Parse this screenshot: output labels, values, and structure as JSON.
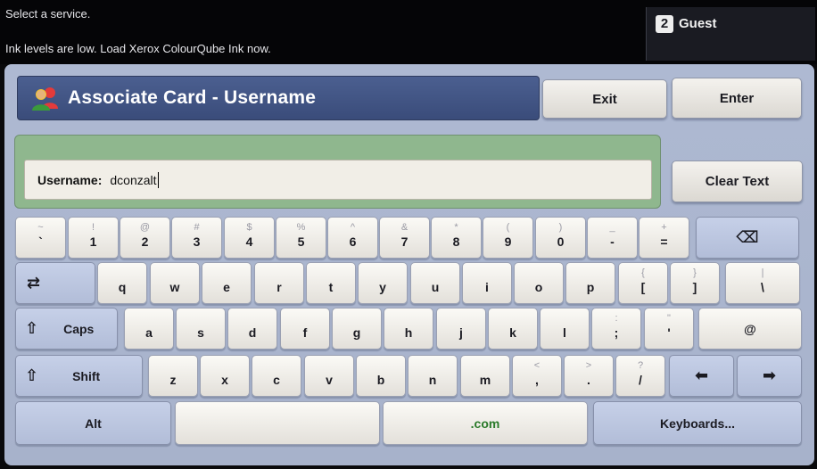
{
  "status": {
    "line1": "Select a service.",
    "line2": "Ink levels are low. Load Xerox ColourQube Ink now."
  },
  "guest": {
    "icon": "user-help-icon",
    "icon_glyph": "2",
    "label": "Guest"
  },
  "header": {
    "title": "Associate Card - Username",
    "icon": "people-icon"
  },
  "buttons": {
    "exit": "Exit",
    "enter": "Enter",
    "clear_text": "Clear Text"
  },
  "username": {
    "label": "Username:",
    "value": "dconzalt"
  },
  "keyboard": {
    "rows": [
      [
        {
          "name": "backtick",
          "top": "~",
          "main": "`"
        },
        {
          "name": "1",
          "top": "!",
          "main": "1"
        },
        {
          "name": "2",
          "top": "@",
          "main": "2"
        },
        {
          "name": "3",
          "top": "#",
          "main": "3"
        },
        {
          "name": "4",
          "top": "$",
          "main": "4"
        },
        {
          "name": "5",
          "top": "%",
          "main": "5"
        },
        {
          "name": "6",
          "top": "^",
          "main": "6"
        },
        {
          "name": "7",
          "top": "&",
          "main": "7"
        },
        {
          "name": "8",
          "top": "*",
          "main": "8"
        },
        {
          "name": "9",
          "top": "(",
          "main": "9"
        },
        {
          "name": "0",
          "top": ")",
          "main": "0"
        },
        {
          "name": "minus",
          "top": "_",
          "main": "-"
        },
        {
          "name": "equals",
          "top": "+",
          "main": "="
        },
        {
          "name": "backspace",
          "main": "⌫",
          "icon": "backspace-icon",
          "style": "blue"
        }
      ],
      [
        {
          "name": "tab",
          "main": "⇄",
          "icon": "tab-icon",
          "style": "blue"
        },
        {
          "name": "q",
          "main": "q"
        },
        {
          "name": "w",
          "main": "w"
        },
        {
          "name": "e",
          "main": "e"
        },
        {
          "name": "r",
          "main": "r"
        },
        {
          "name": "t",
          "main": "t"
        },
        {
          "name": "y",
          "main": "y"
        },
        {
          "name": "u",
          "main": "u"
        },
        {
          "name": "i",
          "main": "i"
        },
        {
          "name": "o",
          "main": "o"
        },
        {
          "name": "p",
          "main": "p"
        },
        {
          "name": "lbracket",
          "top": "{",
          "main": "["
        },
        {
          "name": "rbracket",
          "top": "}",
          "main": "]"
        },
        {
          "name": "backslash",
          "top": "|",
          "main": "\\"
        }
      ],
      [
        {
          "name": "caps",
          "main": "Caps",
          "icon": "shift-icon",
          "style": "blue"
        },
        {
          "name": "a",
          "main": "a"
        },
        {
          "name": "s",
          "main": "s"
        },
        {
          "name": "d",
          "main": "d"
        },
        {
          "name": "f",
          "main": "f"
        },
        {
          "name": "g",
          "main": "g"
        },
        {
          "name": "h",
          "main": "h"
        },
        {
          "name": "j",
          "main": "j"
        },
        {
          "name": "k",
          "main": "k"
        },
        {
          "name": "l",
          "main": "l"
        },
        {
          "name": "semicolon",
          "top": ":",
          "main": ";"
        },
        {
          "name": "quote",
          "top": "\"",
          "main": "'"
        },
        {
          "name": "at",
          "main": "@"
        }
      ],
      [
        {
          "name": "shift",
          "main": "Shift",
          "icon": "shift-icon",
          "style": "blue"
        },
        {
          "name": "z",
          "main": "z"
        },
        {
          "name": "x",
          "main": "x"
        },
        {
          "name": "c",
          "main": "c"
        },
        {
          "name": "v",
          "main": "v"
        },
        {
          "name": "b",
          "main": "b"
        },
        {
          "name": "n",
          "main": "n"
        },
        {
          "name": "m",
          "main": "m"
        },
        {
          "name": "comma",
          "top": "<",
          "main": ","
        },
        {
          "name": "period",
          "top": ">",
          "main": "."
        },
        {
          "name": "slash",
          "top": "?",
          "main": "/"
        },
        {
          "name": "left-arrow",
          "main": "⬅",
          "icon": "arrow-left-icon",
          "style": "blue"
        },
        {
          "name": "right-arrow",
          "main": "➡",
          "icon": "arrow-right-icon",
          "style": "blue"
        }
      ],
      [
        {
          "name": "alt",
          "main": "Alt",
          "style": "blue"
        },
        {
          "name": "space",
          "main": ""
        },
        {
          "name": "dotcom",
          "main": ".com"
        },
        {
          "name": "keyboards",
          "main": "Keyboards...",
          "style": "blue"
        }
      ]
    ]
  }
}
